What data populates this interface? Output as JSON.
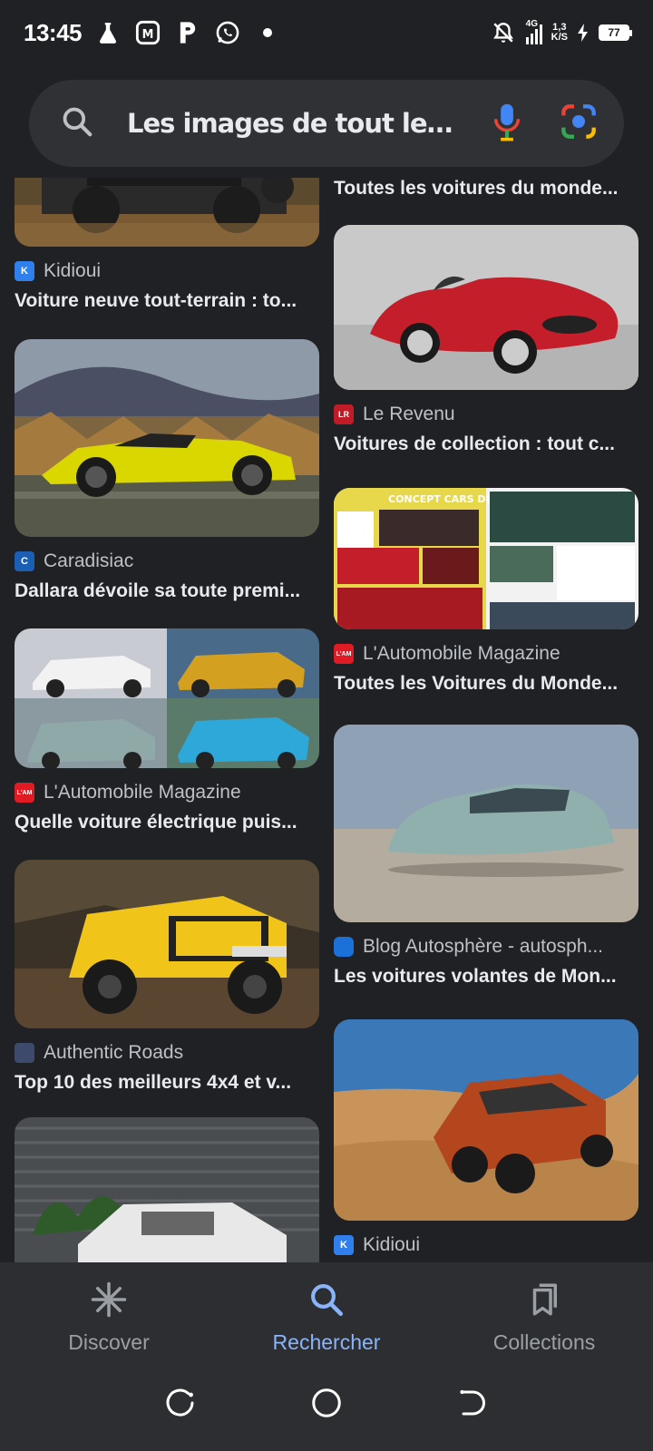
{
  "status_bar": {
    "time": "13:45",
    "network_type": "4G",
    "speed_value": "1,3",
    "speed_unit": "K/S",
    "battery": "77"
  },
  "search": {
    "query": "Les images de tout les v..."
  },
  "results": {
    "left": [
      {
        "source": "Kidioui",
        "title": "Voiture neuve tout-terrain : to...",
        "favicon_color": "#2f80ed"
      },
      {
        "source": "Caradisiac",
        "title": "Dallara dévoile sa toute premi...",
        "favicon_color": "#1a5fb4"
      },
      {
        "source": "L'Automobile Magazine",
        "title": "Quelle voiture électrique puis...",
        "favicon_color": "#e01b24"
      },
      {
        "source": "Authentic Roads",
        "title": "Top 10 des meilleurs 4x4 et v...",
        "favicon_color": "#3d4a6b"
      },
      {
        "source": "",
        "title": ""
      }
    ],
    "right": [
      {
        "source": "",
        "title": "Toutes les voitures du monde..."
      },
      {
        "source": "Le Revenu",
        "title": "Voitures de collection : tout c...",
        "favicon_color": "#c01c28"
      },
      {
        "source": "L'Automobile Magazine",
        "title": "Toutes les Voitures du Monde...",
        "favicon_color": "#e01b24"
      },
      {
        "source": "Blog Autosphère - autosph...",
        "title": "Les voitures volantes de Mon...",
        "favicon_color": "#1c71d8"
      },
      {
        "source": "Kidioui",
        "title": "",
        "favicon_color": "#2f80ed"
      }
    ],
    "magazine_banner": "CONCEPT CARS DU MONDE"
  },
  "bottom_nav": {
    "discover": "Discover",
    "search": "Rechercher",
    "collections": "Collections"
  },
  "colors": {
    "background": "#202124",
    "active": "#8ab4f8"
  }
}
